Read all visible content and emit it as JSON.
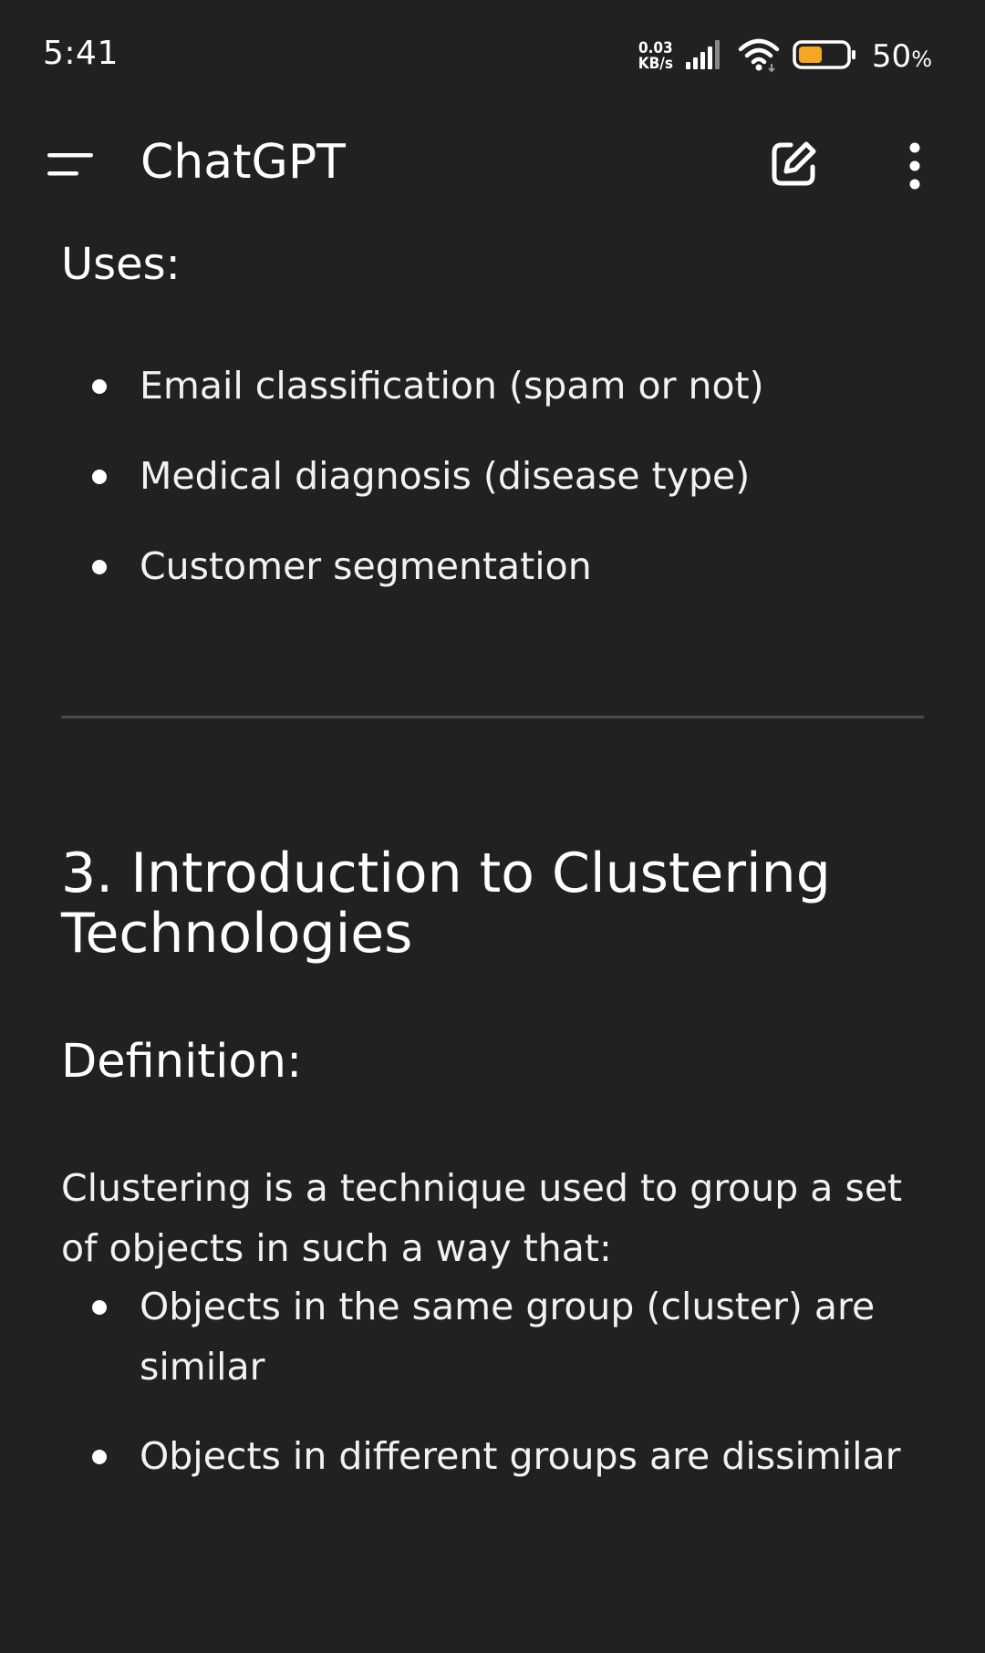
{
  "status_bar": {
    "time": "5:41",
    "net_speed_value": "0.03",
    "net_speed_unit": "KB/s",
    "battery_percent": "50",
    "battery_percent_sign": "%",
    "battery_level": 0.5,
    "battery_color": "#F5A623",
    "icons": [
      "signal-icon",
      "wifi-icon",
      "battery-icon"
    ]
  },
  "app_bar": {
    "title": "ChatGPT",
    "icons": [
      "menu-icon",
      "new-chat-icon",
      "more-options-icon"
    ]
  },
  "content": {
    "uses_heading": "Uses:",
    "uses_items": [
      "Email classification (spam or not)",
      "Medical diagnosis (disease type)",
      "Customer segmentation"
    ],
    "section_heading": "3. Introduction to Clustering Technologies",
    "definition_heading": "Definition:",
    "definition_paragraph": "Clustering is a technique used to group a set of objects in such a way that:",
    "definition_items": [
      "Objects in the same group (cluster) are similar",
      "Objects in different groups are dissimilar"
    ]
  },
  "colors": {
    "background": "#212121",
    "text": "#FFFFFF",
    "divider": "#4A4A4A"
  }
}
